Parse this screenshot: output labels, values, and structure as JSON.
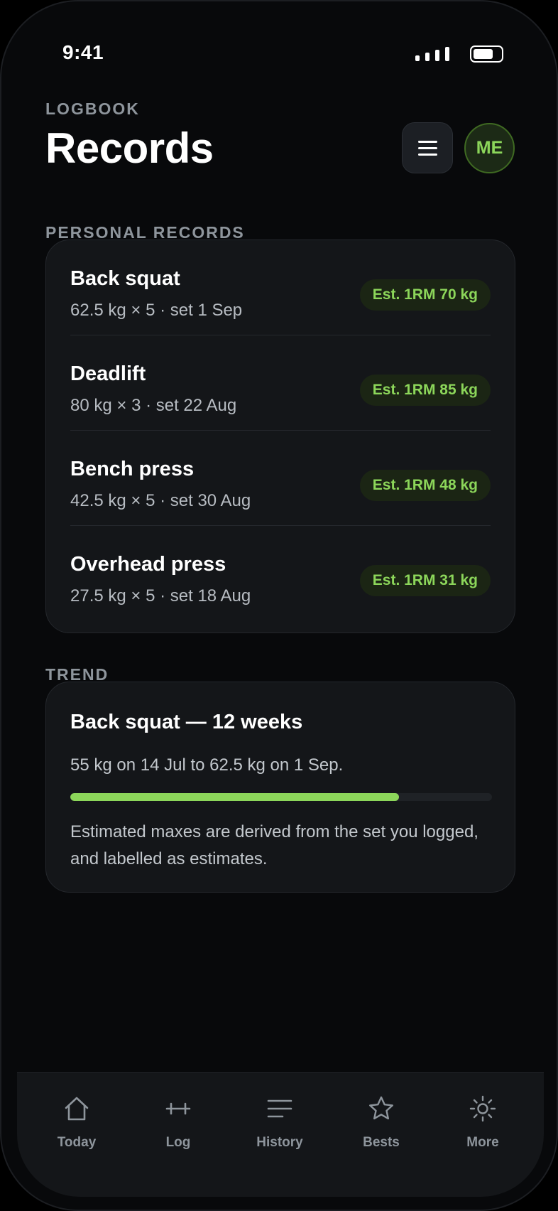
{
  "status_bar": {
    "time": "9:41"
  },
  "header": {
    "eyebrow": "LOGBOOK",
    "title": "Records",
    "avatar_initials": "ME"
  },
  "records_section": {
    "label": "PERSONAL RECORDS",
    "items": [
      {
        "name": "Back squat",
        "detail": "62.5 kg × 5 · set 1 Sep",
        "badge": "Est. 1RM 70 kg"
      },
      {
        "name": "Deadlift",
        "detail": "80 kg × 3 · set 22 Aug",
        "badge": "Est. 1RM 85 kg"
      },
      {
        "name": "Bench press",
        "detail": "42.5 kg × 5 · set 30 Aug",
        "badge": "Est. 1RM 48 kg"
      },
      {
        "name": "Overhead press",
        "detail": "27.5 kg × 5 · set 18 Aug",
        "badge": "Est. 1RM 31 kg"
      }
    ]
  },
  "trend_section": {
    "label": "TREND",
    "title": "Back squat — 12 weeks",
    "summary": "55 kg on 14 Jul to 62.5 kg on 1 Sep.",
    "progress_fraction": 0.78,
    "note": "Estimated maxes are derived from the set you logged, and labelled as estimates."
  },
  "tabbar": {
    "tabs": [
      {
        "label": "Today",
        "icon": "home-icon"
      },
      {
        "label": "Log",
        "icon": "dumbbell-icon"
      },
      {
        "label": "History",
        "icon": "list-icon"
      },
      {
        "label": "Bests",
        "icon": "star-icon"
      },
      {
        "label": "More",
        "icon": "sun-icon"
      }
    ]
  },
  "colors": {
    "accent": "#8cd65a",
    "background": "#08090b",
    "card": "#141619",
    "muted_text": "#8e959c"
  }
}
